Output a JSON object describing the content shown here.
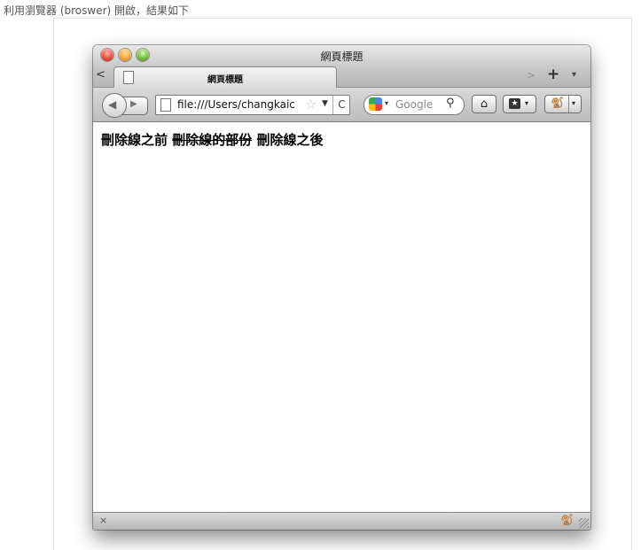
{
  "caption": "利用瀏覽器 (broswer) 開啟，結果如下",
  "window": {
    "title": "網頁標題",
    "tab": {
      "label": "網頁標題"
    },
    "tab_scroll_left_label": "<",
    "tab_scroll_right_label": ">",
    "new_tab_label": "+",
    "tab_list_label": "▾"
  },
  "toolbar": {
    "back_icon": "back-arrow-icon",
    "forward_icon": "forward-arrow-icon",
    "url": "file:///Users/changkaic",
    "bookmark_star": "☆",
    "url_dropdown": "▼",
    "reload_label": "C",
    "search_engine": "Google",
    "search_dropdown": "▾",
    "search_icon": "🔍",
    "home_label": "⌂",
    "bookmarks_label": "★",
    "bookmarks_dropdown": "▾",
    "addon_dropdown": "▾"
  },
  "content": {
    "before": "刪除線之前",
    "struck": "刪除線的部份",
    "after": "刪除線之後"
  },
  "statusbar": {
    "close_label": "×"
  }
}
